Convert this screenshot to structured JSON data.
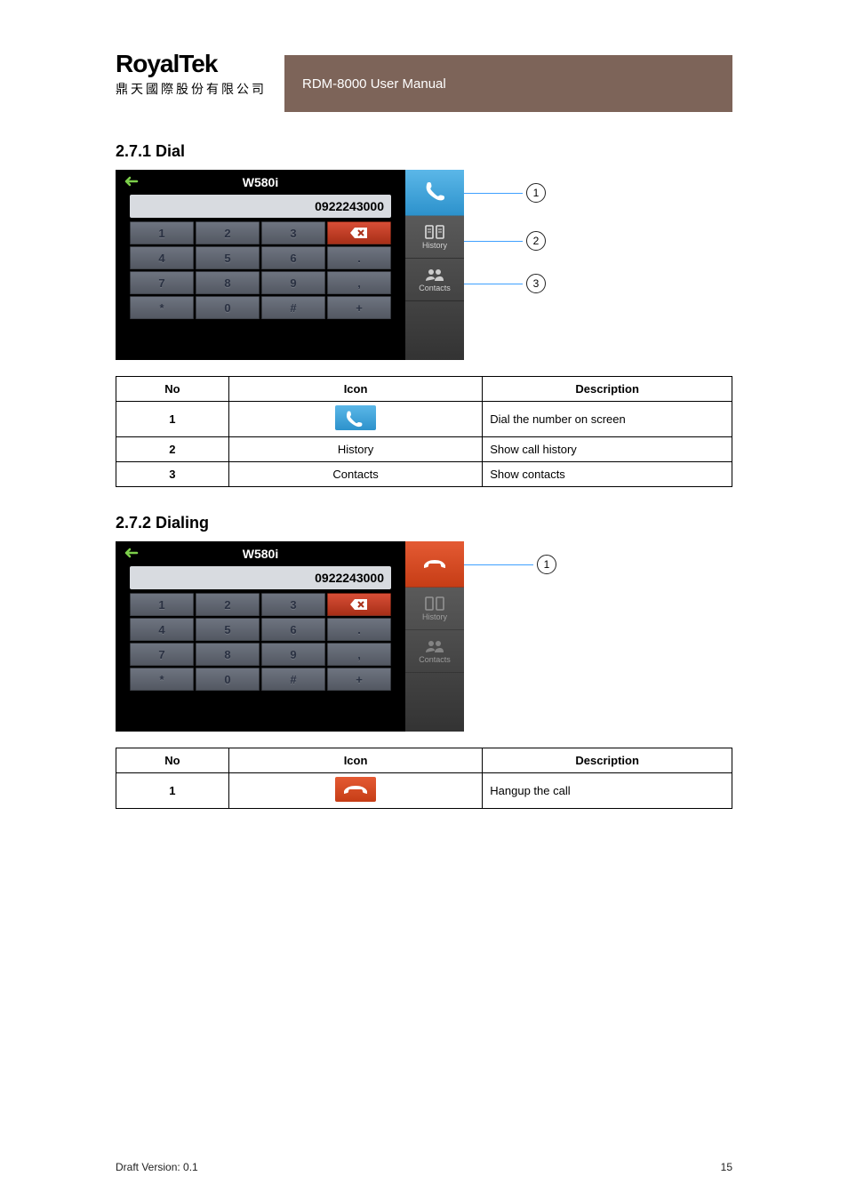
{
  "header": {
    "logo_title": "RoyalTek",
    "logo_sub": "鼎天國際股份有限公司",
    "bar_text": "RDM-8000 User Manual"
  },
  "section1": {
    "title": "2.7.1 Dial",
    "device_title": "W580i",
    "number": "0922243000",
    "keys": [
      "1",
      "2",
      "3",
      "⌫",
      "4",
      "5",
      "6",
      ".",
      "7",
      "8",
      "9",
      ",",
      "*",
      "0",
      "#",
      "+"
    ],
    "callouts": {
      "a": "1",
      "b": "2",
      "c": "3"
    },
    "sidebar": {
      "history": "History",
      "contacts": "Contacts"
    }
  },
  "table1": {
    "head": {
      "no": "No",
      "icon": "Icon",
      "desc": "Description"
    },
    "rows": [
      {
        "no": "1",
        "icon": "dial",
        "desc": "Dial the number on screen"
      },
      {
        "no": "2",
        "icon_text": "History",
        "desc": "Show call history"
      },
      {
        "no": "3",
        "icon_text": "Contacts",
        "desc": "Show contacts"
      }
    ]
  },
  "section2": {
    "title": "2.7.2 Dialing",
    "device_title": "W580i",
    "number": "0922243000",
    "keys": [
      "1",
      "2",
      "3",
      "⌫",
      "4",
      "5",
      "6",
      ".",
      "7",
      "8",
      "9",
      ",",
      "*",
      "0",
      "#",
      "+"
    ],
    "callouts": {
      "a": "1"
    },
    "sidebar": {
      "history": "History",
      "contacts": "Contacts"
    }
  },
  "table2": {
    "head": {
      "no": "No",
      "icon": "Icon",
      "desc": "Description"
    },
    "rows": [
      {
        "no": "1",
        "icon": "hang",
        "desc": "Hangup the call"
      }
    ]
  },
  "footer": {
    "left": "Draft Version: 0.1",
    "right": "15"
  }
}
